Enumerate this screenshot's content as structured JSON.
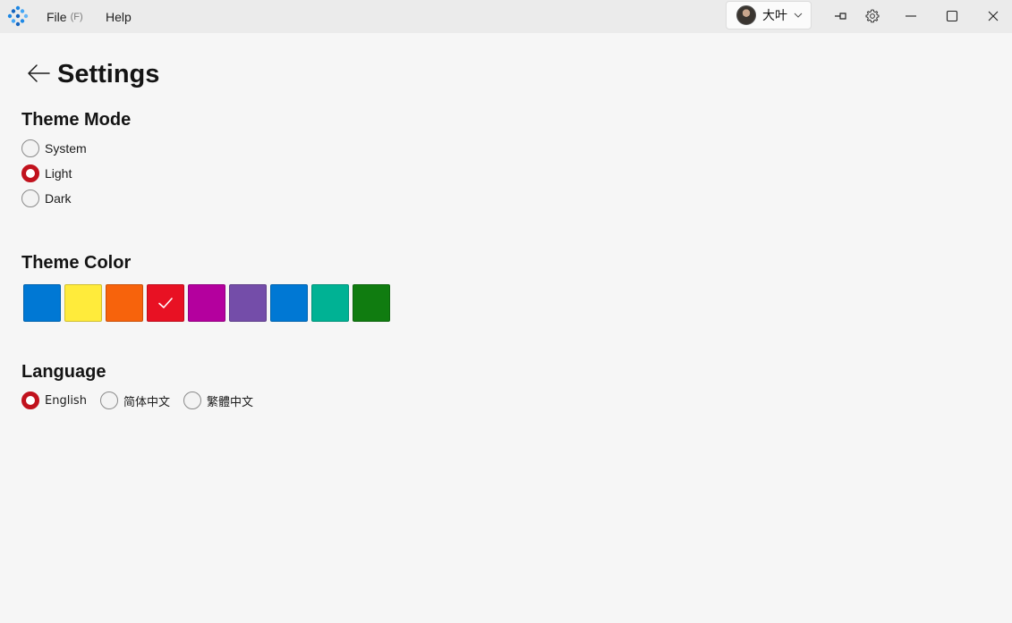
{
  "titlebar": {
    "menus": [
      {
        "label": "File",
        "shortcut": "(F)"
      },
      {
        "label": "Help"
      }
    ],
    "user": {
      "name": "大叶"
    },
    "icons": [
      "app-logo-icon",
      "pin-icon",
      "gear-icon",
      "minimize-icon",
      "maximize-icon",
      "close-icon"
    ]
  },
  "page": {
    "title": "Settings"
  },
  "theme_mode": {
    "title": "Theme Mode",
    "options": [
      {
        "label": "System",
        "checked": false
      },
      {
        "label": "Light",
        "checked": true
      },
      {
        "label": "Dark",
        "checked": false
      }
    ]
  },
  "theme_color": {
    "title": "Theme Color",
    "selected_index": 3,
    "colors": [
      "#0078d4",
      "#ffeb3b",
      "#f7630c",
      "#e81123",
      "#b4009e",
      "#744da9",
      "#0078d4",
      "#00b294",
      "#107c10"
    ]
  },
  "language": {
    "title": "Language",
    "options": [
      {
        "label": "English",
        "checked": true
      },
      {
        "label": "简体中文",
        "checked": false
      },
      {
        "label": "繁體中文",
        "checked": false
      }
    ]
  },
  "accent": "#c1121d"
}
